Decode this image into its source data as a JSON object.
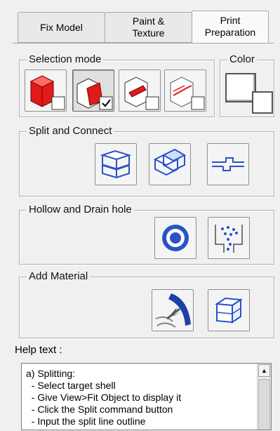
{
  "tabs": [
    {
      "label": "Fix Model",
      "active": false
    },
    {
      "label": "Paint &\nTexture",
      "active": false
    },
    {
      "label": "Print\nPreparation",
      "active": true
    }
  ],
  "selection_mode": {
    "label": "Selection mode",
    "buttons": [
      {
        "icon": "select-shell-icon",
        "pressed": false
      },
      {
        "icon": "select-triangle-icon",
        "pressed": true
      },
      {
        "icon": "select-edge-icon",
        "pressed": false
      },
      {
        "icon": "select-border-icon",
        "pressed": false
      }
    ]
  },
  "color": {
    "label": "Color",
    "swatch": "#ffffff"
  },
  "split_connect": {
    "label": "Split and Connect",
    "buttons": [
      {
        "icon": "split-plane-icon"
      },
      {
        "icon": "split-intersect-icon"
      },
      {
        "icon": "connect-icon"
      }
    ]
  },
  "hollow": {
    "label": "Hollow and Drain hole",
    "buttons": [
      {
        "icon": "hollow-icon"
      },
      {
        "icon": "drain-hole-icon"
      }
    ]
  },
  "add_material": {
    "label": "Add Material",
    "buttons": [
      {
        "icon": "add-thickness-icon"
      },
      {
        "icon": "add-box-icon"
      }
    ]
  },
  "help": {
    "label": "Help text :",
    "lines": [
      "a) Splitting:",
      "  - Select target shell",
      "  - Give View>Fit Object to display it",
      "  - Click the Split command button",
      "  - Input the split line outline"
    ]
  },
  "colors": {
    "accent_red": "#e11a1a",
    "accent_blue": "#2a52c8"
  }
}
